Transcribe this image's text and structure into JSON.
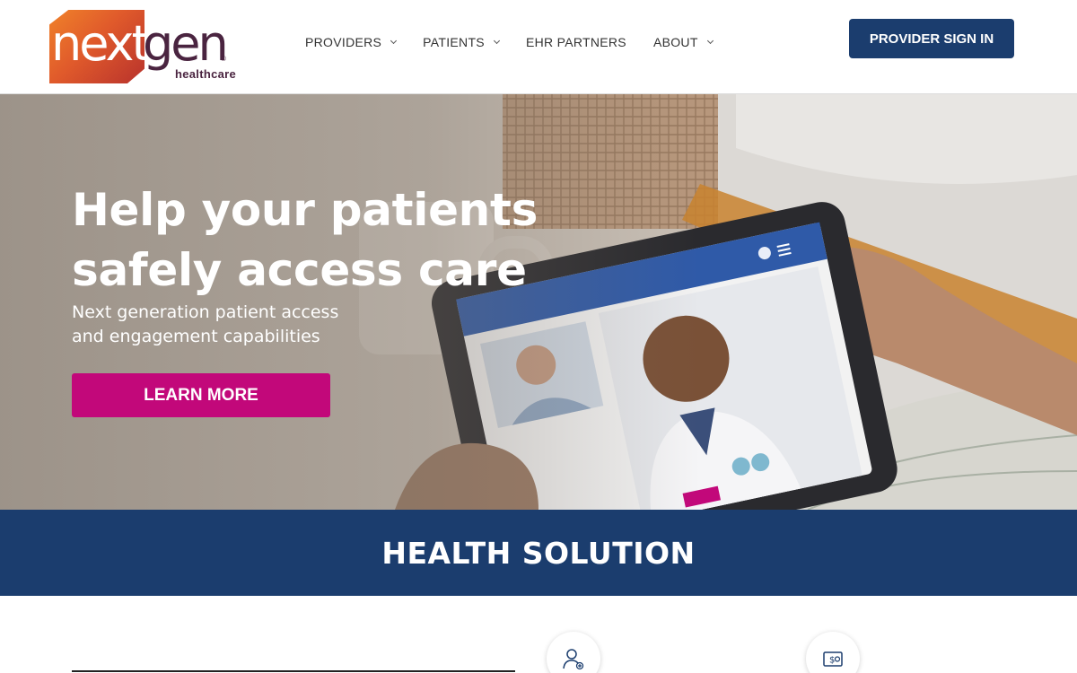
{
  "header": {
    "logo_main_left": "next",
    "logo_main_right": "gen",
    "logo_registered": "®",
    "logo_sub": "healthcare",
    "nav": [
      {
        "label": "PROVIDERS",
        "has_dropdown": true
      },
      {
        "label": "PATIENTS",
        "has_dropdown": true
      },
      {
        "label": "EHR PARTNERS",
        "has_dropdown": false
      },
      {
        "label": "ABOUT",
        "has_dropdown": true
      }
    ],
    "signin_label": "PROVIDER SIGN IN"
  },
  "hero": {
    "title_line1": "Help your patients",
    "title_line2": "safely access care",
    "subtitle_line1": "Next generation patient access",
    "subtitle_line2": "and engagement capabilities",
    "cta_label": "LEARN MORE",
    "image_icon": "telehealth-tablet-photo"
  },
  "banner": {
    "title": "HEALTH SOLUTION"
  },
  "features": {
    "icons": [
      "doctor-icon",
      "payment-icon"
    ]
  },
  "colors": {
    "brand_navy": "#1b3d6e",
    "cta_magenta": "#c2087a",
    "logo_orange": "#e05a2b",
    "logo_plum": "#4a2440"
  }
}
